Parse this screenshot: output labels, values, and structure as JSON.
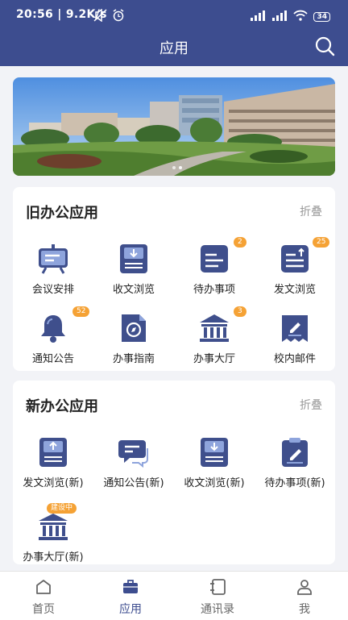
{
  "status_bar": {
    "time": "20:56 | 9.2K/s",
    "battery": "34"
  },
  "header": {
    "title": "应用"
  },
  "old_apps": {
    "title": "旧办公应用",
    "collapse_label": "折叠",
    "items": [
      {
        "label": "会议安排"
      },
      {
        "label": "收文浏览"
      },
      {
        "label": "待办事项",
        "badge": "2"
      },
      {
        "label": "发文浏览",
        "badge": "25"
      },
      {
        "label": "通知公告",
        "badge": "52"
      },
      {
        "label": "办事指南"
      },
      {
        "label": "办事大厅",
        "badge": "3"
      },
      {
        "label": "校内邮件"
      }
    ]
  },
  "new_apps": {
    "title": "新办公应用",
    "collapse_label": "折叠",
    "items": [
      {
        "label": "发文浏览(新)"
      },
      {
        "label": "通知公告(新)"
      },
      {
        "label": "收文浏览(新)"
      },
      {
        "label": "待办事项(新)"
      },
      {
        "label": "办事大厅(新)",
        "badge": "建设中"
      }
    ]
  },
  "tabs": [
    {
      "label": "首页",
      "icon": "home-icon"
    },
    {
      "label": "应用",
      "icon": "briefcase-icon"
    },
    {
      "label": "通讯录",
      "icon": "contacts-icon"
    },
    {
      "label": "我",
      "icon": "person-icon"
    }
  ],
  "colors": {
    "primary": "#3d4d8f",
    "icon_fill": "#3f4f8c",
    "badge": "#f5a235"
  }
}
